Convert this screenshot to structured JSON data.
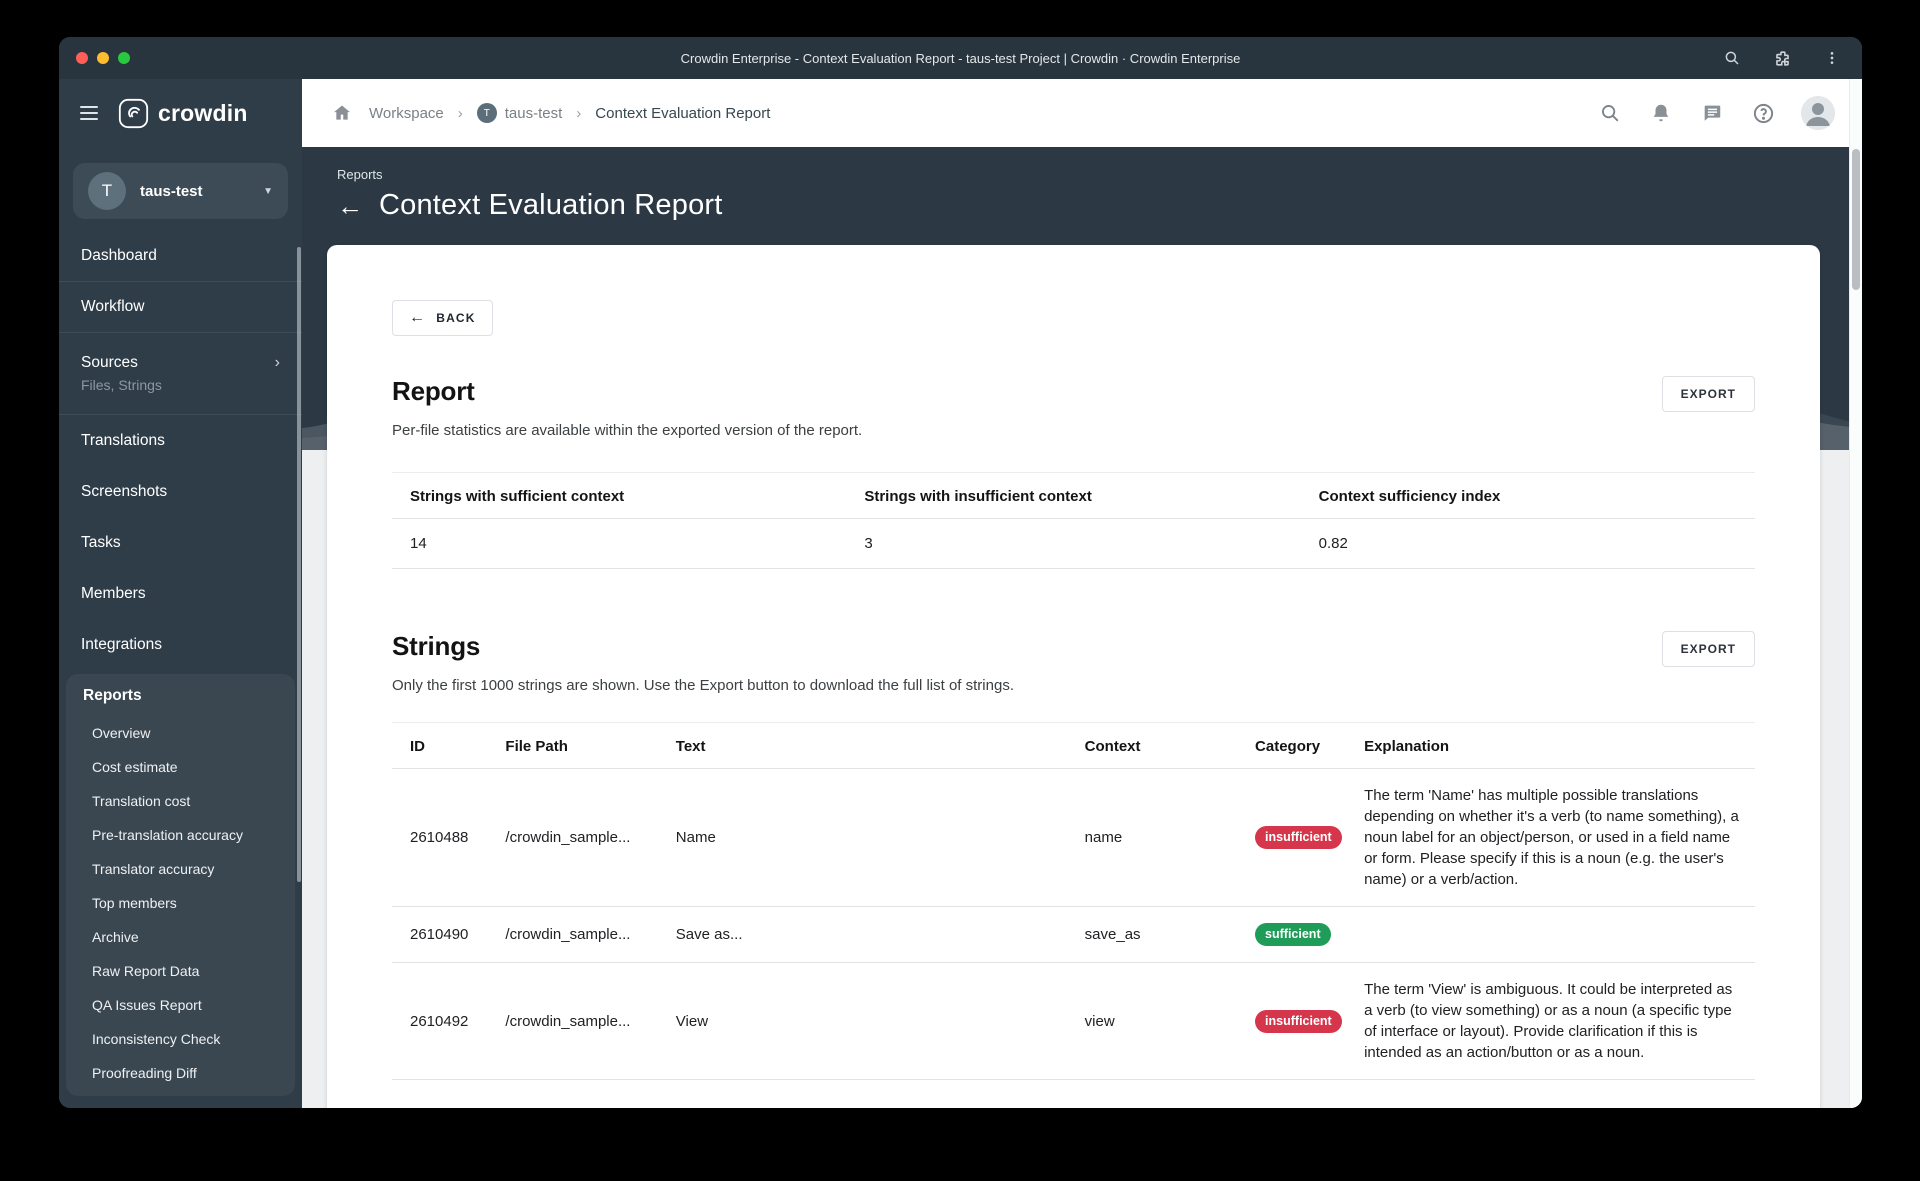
{
  "window": {
    "title": "Crowdin Enterprise - Context Evaluation Report - taus-test Project | Crowdin · Crowdin Enterprise"
  },
  "sidebar": {
    "logo": "crowdin",
    "project": {
      "initial": "T",
      "name": "taus-test"
    },
    "items": [
      {
        "label": "Dashboard"
      },
      {
        "label": "Workflow"
      },
      {
        "label": "Sources",
        "subtitle": "Files, Strings"
      },
      {
        "label": "Translations"
      },
      {
        "label": "Screenshots"
      },
      {
        "label": "Tasks"
      },
      {
        "label": "Members"
      },
      {
        "label": "Integrations"
      }
    ],
    "reports": {
      "label": "Reports",
      "items": [
        "Overview",
        "Cost estimate",
        "Translation cost",
        "Pre-translation accuracy",
        "Translator accuracy",
        "Top members",
        "Archive",
        "Raw Report Data",
        "QA Issues Report",
        "Inconsistency Check",
        "Proofreading Diff"
      ]
    }
  },
  "breadcrumb": {
    "workspace": "Workspace",
    "project_initial": "T",
    "project": "taus-test",
    "current": "Context Evaluation Report"
  },
  "hero": {
    "eyebrow": "Reports",
    "title": "Context Evaluation Report"
  },
  "report": {
    "back_label": "BACK",
    "title": "Report",
    "export_label": "EXPORT",
    "subtitle": "Per-file statistics are available within the exported version of the report.",
    "stats": {
      "headers": [
        "Strings with sufficient context",
        "Strings with insufficient context",
        "Context sufficiency index"
      ],
      "values": [
        "14",
        "3",
        "0.82"
      ]
    }
  },
  "strings": {
    "title": "Strings",
    "export_label": "EXPORT",
    "subtitle": "Only the first 1000 strings are shown. Use the Export button to download the full list of strings.",
    "headers": [
      "ID",
      "File Path",
      "Text",
      "Context",
      "Category",
      "Explanation"
    ],
    "rows": [
      {
        "id": "2610488",
        "file_path": "/crowdin_sample...",
        "text": "Name",
        "context": "name",
        "category": "insufficient",
        "explanation": "The term 'Name' has multiple possible translations depending on whether it's a verb (to name something), a noun label for an object/person, or used in a field name or form. Please specify if this is a noun (e.g. the user's name) or a verb/action."
      },
      {
        "id": "2610490",
        "file_path": "/crowdin_sample...",
        "text": "Save as...",
        "context": "save_as",
        "category": "sufficient",
        "explanation": ""
      },
      {
        "id": "2610492",
        "file_path": "/crowdin_sample...",
        "text": "View",
        "context": "view",
        "category": "insufficient",
        "explanation": "The term 'View' is ambiguous. It could be interpreted as a verb (to view something) or as a noun (a specific type of interface or layout). Provide clarification if this is intended as an action/button or as a noun."
      }
    ]
  },
  "colors": {
    "badge_insufficient": "#d6364b",
    "badge_sufficient": "#1f9d58",
    "titlebar_bg": "#28343e",
    "sidebar_bg": "#2f3d48",
    "hero_bg": "#2c3945",
    "page_bg": "#edeff1"
  }
}
